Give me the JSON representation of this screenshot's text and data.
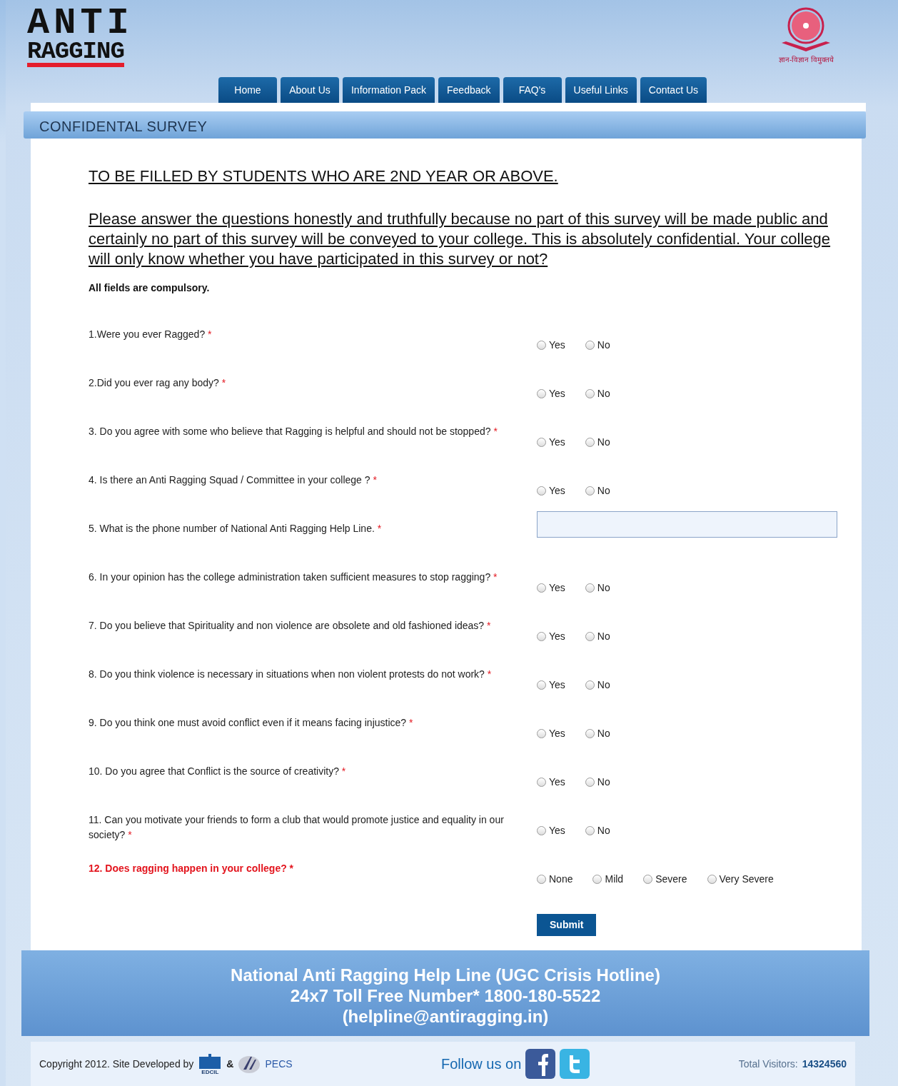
{
  "logo": {
    "line_1": "ANTI",
    "line_2": "RAGGING"
  },
  "emblem": {
    "motto": "ज्ञान-विज्ञान विमुक्तये"
  },
  "nav": [
    {
      "label": "Home"
    },
    {
      "label": "About Us"
    },
    {
      "label": "Information Pack"
    },
    {
      "label": "Feedback"
    },
    {
      "label": "FAQ's"
    },
    {
      "label": "Useful Links"
    },
    {
      "label": "Contact Us"
    }
  ],
  "page_title": "CONFIDENTAL SURVEY",
  "heading": "TO BE FILLED BY STUDENTS WHO ARE 2ND YEAR OR ABOVE.",
  "intro": "Please answer the questions honestly and truthfully because no part of this survey will be made public and certainly no part of this survey will be conveyed to your college. This is absolutely confidential. Your college will only know whether you have participated in this survey or not?",
  "note": "All fields are compulsory.",
  "questions": [
    {
      "text": "1.Were you ever Ragged?",
      "required": true,
      "highlight": false,
      "kind": "radio",
      "options": [
        {
          "label": "Yes",
          "selected": false
        },
        {
          "label": "No",
          "selected": false
        }
      ]
    },
    {
      "text": "2.Did you ever rag any body?",
      "required": true,
      "highlight": false,
      "kind": "radio",
      "options": [
        {
          "label": "Yes",
          "selected": false
        },
        {
          "label": "No",
          "selected": false
        }
      ]
    },
    {
      "text": "3. Do you agree with some who believe that Ragging is helpful and should not be stopped?",
      "required": true,
      "highlight": false,
      "kind": "radio",
      "options": [
        {
          "label": "Yes",
          "selected": false
        },
        {
          "label": "No",
          "selected": false
        }
      ]
    },
    {
      "text": "4. Is there an Anti Ragging Squad / Committee in your college ?",
      "required": true,
      "highlight": false,
      "kind": "radio",
      "options": [
        {
          "label": "Yes",
          "selected": false
        },
        {
          "label": "No",
          "selected": false
        }
      ]
    },
    {
      "text": "5. What is the phone number of National Anti Ragging Help Line.",
      "required": true,
      "highlight": false,
      "kind": "text"
    },
    {
      "text": "6. In your opinion has the college administration taken sufficient measures to stop ragging?",
      "required": true,
      "highlight": false,
      "kind": "radio",
      "options": [
        {
          "label": "Yes",
          "selected": false
        },
        {
          "label": "No",
          "selected": false
        }
      ]
    },
    {
      "text": "7. Do you believe that Spirituality and non violence are obsolete and old fashioned ideas?",
      "required": true,
      "highlight": false,
      "kind": "radio",
      "options": [
        {
          "label": "Yes",
          "selected": false
        },
        {
          "label": "No",
          "selected": false
        }
      ]
    },
    {
      "text": "8. Do you think violence is necessary in situations when non violent protests do not work?",
      "required": true,
      "highlight": false,
      "kind": "radio",
      "options": [
        {
          "label": "Yes",
          "selected": false
        },
        {
          "label": "No",
          "selected": false
        }
      ]
    },
    {
      "text": "9. Do you think one must avoid conflict even if it means facing injustice?",
      "required": true,
      "highlight": false,
      "kind": "radio",
      "options": [
        {
          "label": "Yes",
          "selected": false
        },
        {
          "label": "No",
          "selected": false
        }
      ]
    },
    {
      "text": "10. Do you agree that Conflict is the source of creativity?",
      "required": true,
      "highlight": false,
      "kind": "radio",
      "options": [
        {
          "label": "Yes",
          "selected": false
        },
        {
          "label": "No",
          "selected": false
        }
      ]
    },
    {
      "text": "11. Can you motivate your friends to form a club that would promote justice and equality in our society?",
      "required": true,
      "highlight": false,
      "kind": "radio",
      "options": [
        {
          "label": "Yes",
          "selected": false
        },
        {
          "label": "No",
          "selected": false
        }
      ]
    },
    {
      "text": "12. Does ragging happen in your college?",
      "required": true,
      "highlight": true,
      "kind": "radio",
      "options": [
        {
          "label": "None",
          "selected": false
        },
        {
          "label": "Mild",
          "selected": false
        },
        {
          "label": "Severe",
          "selected": false
        },
        {
          "label": "Very Severe",
          "selected": false
        }
      ]
    }
  ],
  "required_mark": "*",
  "submit": "Submit",
  "helpline": [
    "National Anti Ragging Help Line (UGC Crisis Hotline)",
    "24x7 Toll Free Number* 1800-180-5522",
    "(helpline@antiragging.in)"
  ],
  "footer": {
    "copyright": "Copyright 2012. Site Developed by",
    "amp": "&",
    "edcil": "EDCIL",
    "pecs": "PECS",
    "follow": "Follow us on",
    "visitors_label": "Total Visitors:",
    "visitors": "14324560"
  }
}
